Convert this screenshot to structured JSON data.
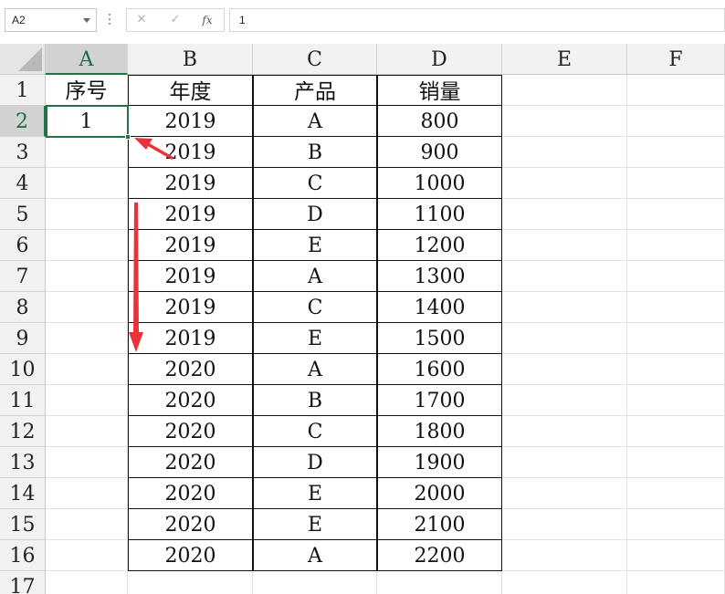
{
  "formula_bar": {
    "name_box": "A2",
    "cancel_icon": "✕",
    "enter_icon": "✓",
    "fx_label": "fx",
    "value": "1"
  },
  "columns": [
    "A",
    "B",
    "C",
    "D",
    "E",
    "F"
  ],
  "rows": [
    "1",
    "2",
    "3",
    "4",
    "5",
    "6",
    "7",
    "8",
    "9",
    "10",
    "11",
    "12",
    "13",
    "14",
    "15",
    "16",
    "17"
  ],
  "headers": {
    "seq": "序号",
    "year": "年度",
    "product": "产品",
    "sales": "销量"
  },
  "selected_cell": {
    "ref": "A2",
    "value": "1"
  },
  "data_rows": [
    {
      "year": "2019",
      "product": "A",
      "sales": "800"
    },
    {
      "year": "2019",
      "product": "B",
      "sales": "900"
    },
    {
      "year": "2019",
      "product": "C",
      "sales": "1000"
    },
    {
      "year": "2019",
      "product": "D",
      "sales": "1100"
    },
    {
      "year": "2019",
      "product": "E",
      "sales": "1200"
    },
    {
      "year": "2019",
      "product": "A",
      "sales": "1300"
    },
    {
      "year": "2019",
      "product": "C",
      "sales": "1400"
    },
    {
      "year": "2019",
      "product": "E",
      "sales": "1500"
    },
    {
      "year": "2020",
      "product": "A",
      "sales": "1600"
    },
    {
      "year": "2020",
      "product": "B",
      "sales": "1700"
    },
    {
      "year": "2020",
      "product": "C",
      "sales": "1800"
    },
    {
      "year": "2020",
      "product": "D",
      "sales": "1900"
    },
    {
      "year": "2020",
      "product": "E",
      "sales": "2000"
    },
    {
      "year": "2020",
      "product": "E",
      "sales": "2100"
    },
    {
      "year": "2020",
      "product": "A",
      "sales": "2200"
    }
  ],
  "annotation_color": "#e8333a",
  "accent_color": "#217346"
}
